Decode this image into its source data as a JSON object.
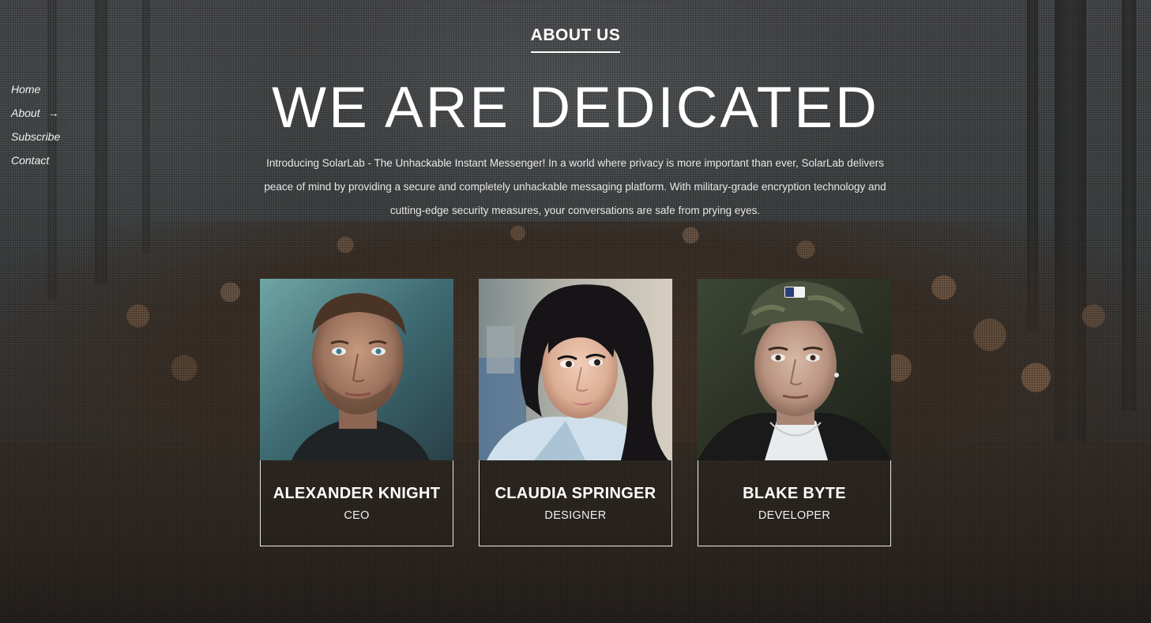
{
  "nav": {
    "items": [
      {
        "label": "Home"
      },
      {
        "label": "About",
        "arrow": "→"
      },
      {
        "label": "Subscribe"
      },
      {
        "label": "Contact"
      }
    ]
  },
  "section": {
    "tag": "ABOUT US",
    "headline": "WE ARE DEDICATED",
    "intro": "Introducing SolarLab - The Unhackable Instant Messenger! In a world where privacy is more important than ever, SolarLab delivers peace of mind by providing a secure and completely unhackable messaging platform. With military-grade encryption technology and cutting-edge security measures, your conversations are safe from prying eyes."
  },
  "team": [
    {
      "name": "ALEXANDER KNIGHT",
      "role": "CEO"
    },
    {
      "name": "CLAUDIA SPRINGER",
      "role": "DESIGNER"
    },
    {
      "name": "BLAKE BYTE",
      "role": "DEVELOPER"
    }
  ]
}
